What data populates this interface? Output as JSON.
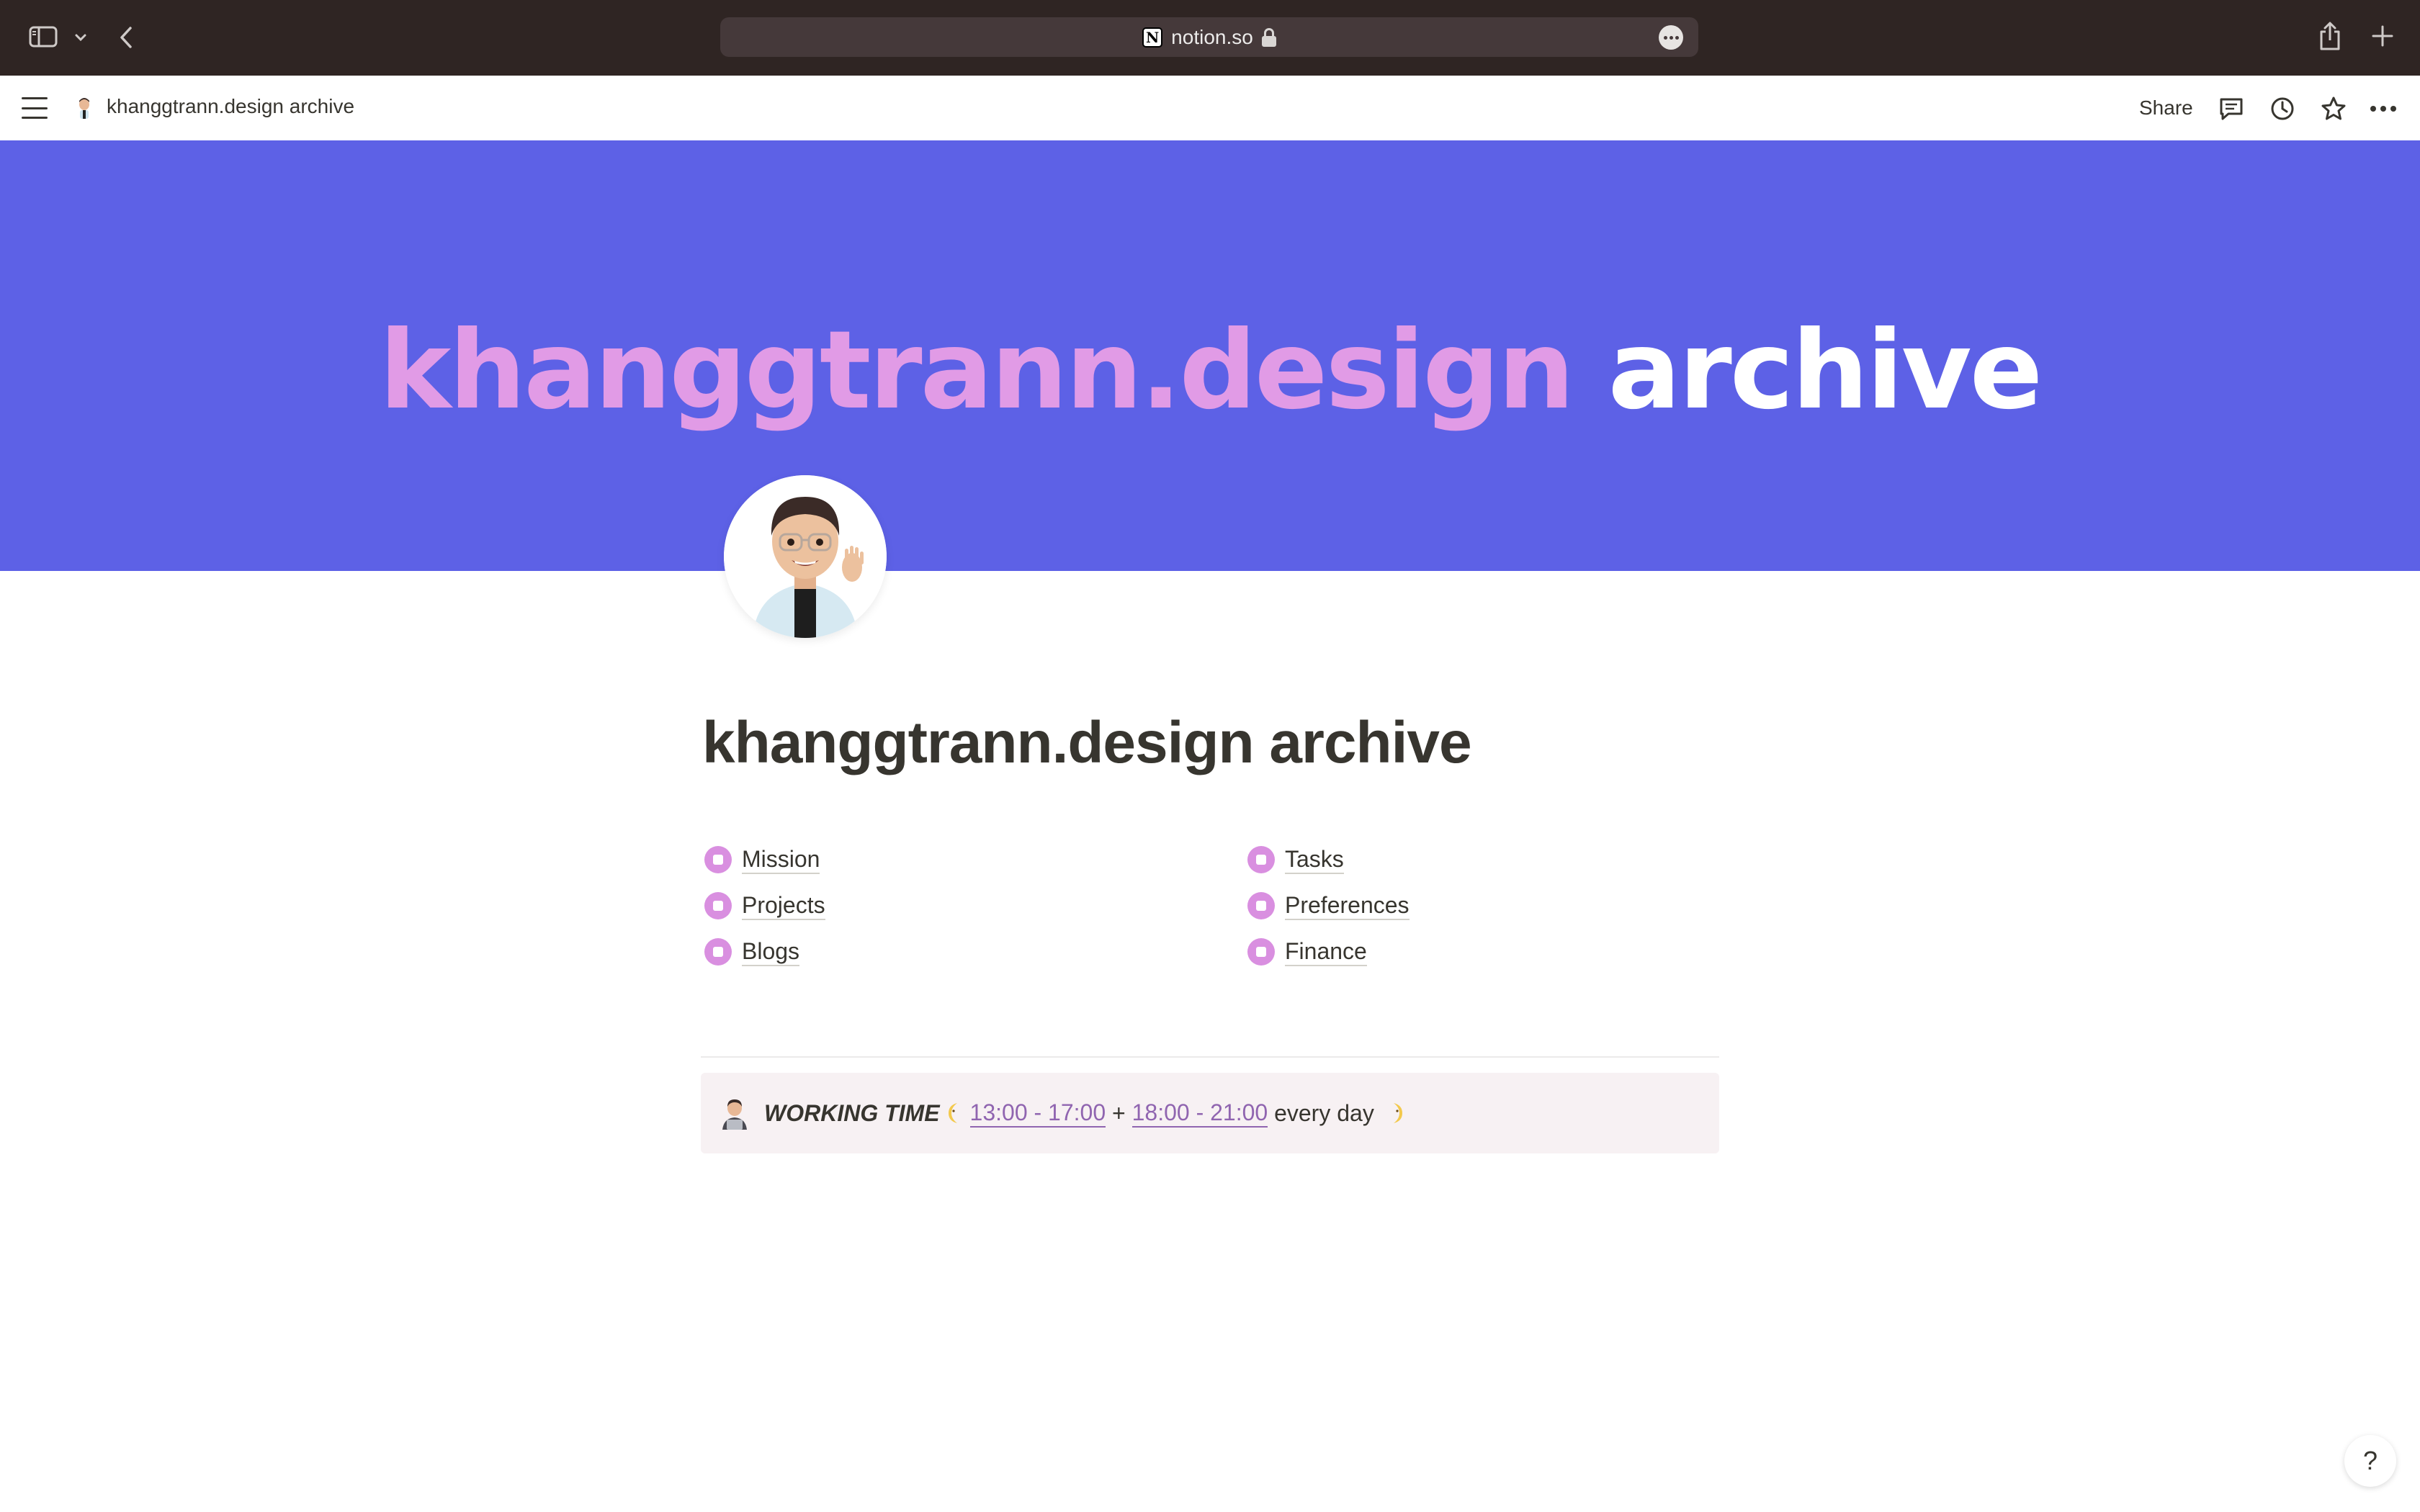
{
  "browser": {
    "url": "notion.so",
    "icons": [
      "sidebar-icon",
      "chevron-down-icon",
      "back-icon",
      "notion-logo-icon",
      "lock-icon",
      "more-icon",
      "share-icon",
      "new-tab-icon"
    ]
  },
  "topbar": {
    "breadcrumb_title": "khanggtrann.design archive",
    "share_label": "Share",
    "icons": [
      "menu-icon",
      "comment-icon",
      "history-icon",
      "star-icon",
      "more-horizontal-icon"
    ]
  },
  "cover": {
    "title_part1": "khanggtrann.design",
    "title_part2": "archive",
    "background_color": "#5d61e6",
    "title_accent_color": "#e19be6"
  },
  "page": {
    "title": "khanggtrann.design archive",
    "links_left": [
      {
        "label": "Mission",
        "icon": "trophy-icon"
      },
      {
        "label": "Projects",
        "icon": "image-icon"
      },
      {
        "label": "Blogs",
        "icon": "note-icon"
      }
    ],
    "links_right": [
      {
        "label": "Tasks",
        "icon": "target-icon"
      },
      {
        "label": "Preferences",
        "icon": "bolt-icon"
      },
      {
        "label": "Finance",
        "icon": "coin-icon"
      }
    ],
    "link_icon_color": "#d98fe0"
  },
  "callout": {
    "label": "WORKING TIME",
    "time1": "13:00 - 17:00",
    "plus": " + ",
    "time2": "18:00 - 21:00",
    "suffix": " every day ",
    "background_color": "#f7f1f3",
    "link_color": "#9065b0"
  },
  "help": {
    "label": "?"
  }
}
